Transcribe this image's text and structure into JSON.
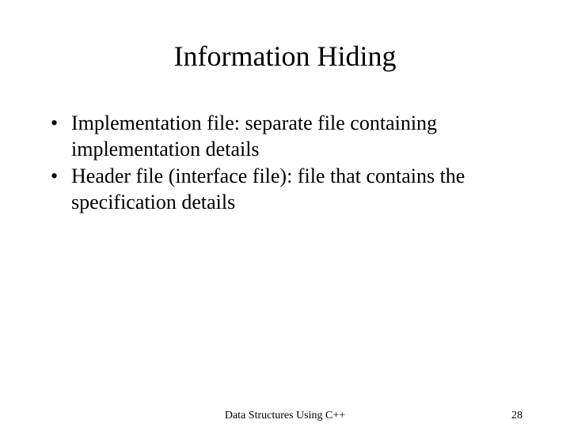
{
  "title": "Information Hiding",
  "bullets": [
    "Implementation file: separate file containing implementation details",
    "Header file (interface file): file that contains the specification details"
  ],
  "footer": {
    "center": "Data Structures Using C++",
    "page": "28"
  }
}
